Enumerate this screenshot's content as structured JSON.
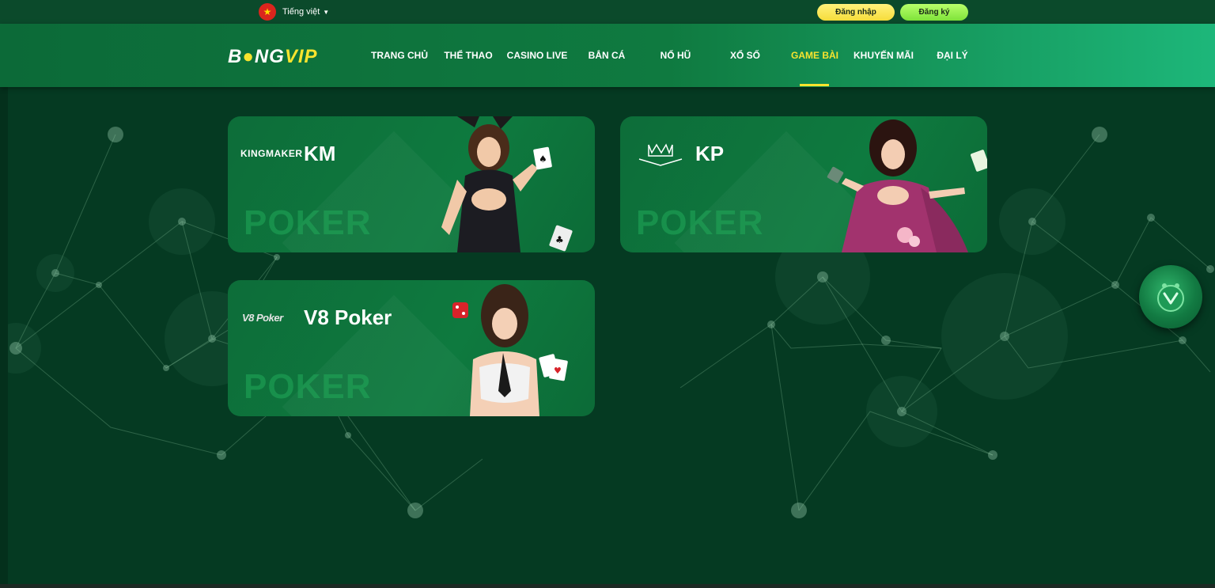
{
  "topbar": {
    "language_label": "Tiếng việt",
    "login_label": "Đăng nhập",
    "register_label": "Đăng ký"
  },
  "header": {
    "logo_part1": "B",
    "logo_part2": "NG",
    "logo_part3": "VIP",
    "nav": [
      {
        "label": "TRANG CHỦ",
        "active": false
      },
      {
        "label": "THỂ THAO",
        "active": false
      },
      {
        "label": "CASINO LIVE",
        "active": false
      },
      {
        "label": "BẮN CÁ",
        "active": false
      },
      {
        "label": "NỔ HŨ",
        "active": false
      },
      {
        "label": "XỔ SỐ",
        "active": false
      },
      {
        "label": "GAME BÀI",
        "active": true
      },
      {
        "label": "KHUYẾN MÃI",
        "active": false
      },
      {
        "label": "ĐẠI LÝ",
        "active": false
      }
    ]
  },
  "games": [
    {
      "provider": "KINGMAKER",
      "title": "KM",
      "background_word": "POKER"
    },
    {
      "provider": "",
      "title": "KP",
      "background_word": "POKER"
    },
    {
      "provider": "V8 Poker",
      "title": "V8 Poker",
      "background_word": "POKER"
    }
  ],
  "colors": {
    "accent": "#f8e42e",
    "page_bg": "#053a22",
    "card_bg": "#0e7a3f",
    "login_button": "#f6dd3b",
    "register_button": "#7fe33a"
  },
  "icons": {
    "flag": "vietnam-flag-icon",
    "language_caret": "caret-down-icon",
    "floating": "bong-mascot-icon"
  }
}
